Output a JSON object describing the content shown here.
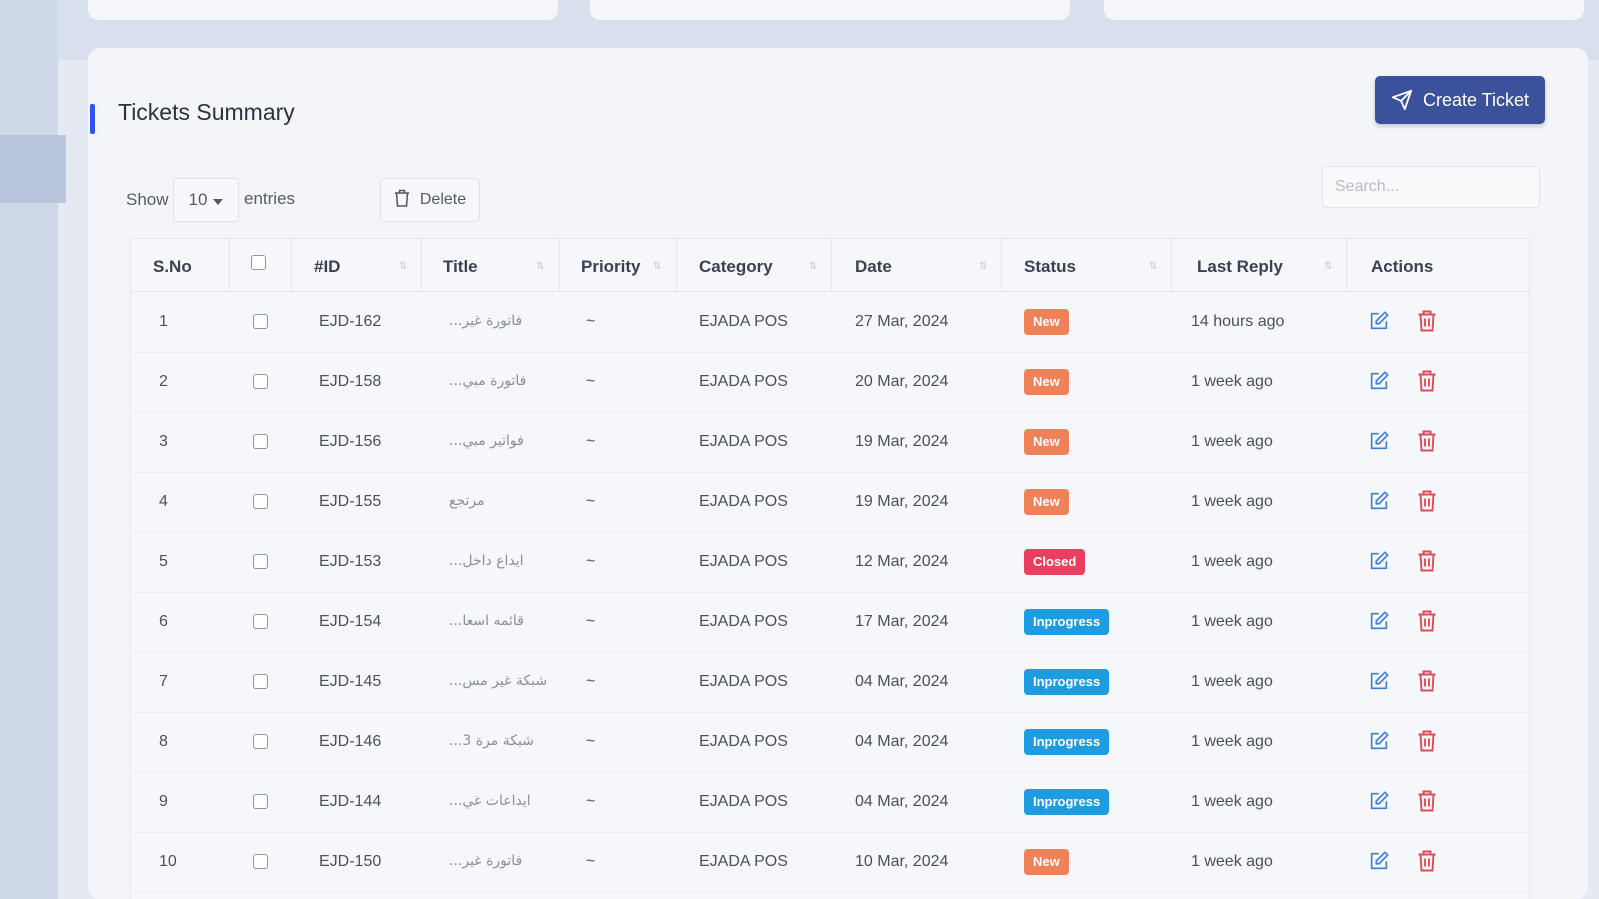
{
  "page": {
    "title": "Tickets Summary"
  },
  "header": {
    "create_button_label": "Create Ticket"
  },
  "controls": {
    "show_label": "Show",
    "entries_value": "10",
    "entries_label": "entries",
    "delete_label": "Delete",
    "search_placeholder": "Search..."
  },
  "table": {
    "columns": [
      "S.No",
      "#ID",
      "Title",
      "Priority",
      "Category",
      "Date",
      "Status",
      "Last Reply",
      "Actions"
    ],
    "rows": [
      {
        "sno": "1",
        "id": "EJD-162",
        "title": "فاتورة غير...",
        "priority": "~",
        "category": "EJADA POS",
        "date": "27 Mar, 2024",
        "status": "New",
        "last_reply": "14 hours ago"
      },
      {
        "sno": "2",
        "id": "EJD-158",
        "title": "فاتورة مبي...",
        "priority": "~",
        "category": "EJADA POS",
        "date": "20 Mar, 2024",
        "status": "New",
        "last_reply": "1 week ago"
      },
      {
        "sno": "3",
        "id": "EJD-156",
        "title": "فواتير مبي...",
        "priority": "~",
        "category": "EJADA POS",
        "date": "19 Mar, 2024",
        "status": "New",
        "last_reply": "1 week ago"
      },
      {
        "sno": "4",
        "id": "EJD-155",
        "title": "مرتجع",
        "priority": "~",
        "category": "EJADA POS",
        "date": "19 Mar, 2024",
        "status": "New",
        "last_reply": "1 week ago"
      },
      {
        "sno": "5",
        "id": "EJD-153",
        "title": "ايداع داخل...",
        "priority": "~",
        "category": "EJADA POS",
        "date": "12 Mar, 2024",
        "status": "Closed",
        "last_reply": "1 week ago"
      },
      {
        "sno": "6",
        "id": "EJD-154",
        "title": "قائمه اسعا...",
        "priority": "~",
        "category": "EJADA POS",
        "date": "17 Mar, 2024",
        "status": "Inprogress",
        "last_reply": "1 week ago"
      },
      {
        "sno": "7",
        "id": "EJD-145",
        "title": "شبكة غير مس...",
        "priority": "~",
        "category": "EJADA POS",
        "date": "04 Mar, 2024",
        "status": "Inprogress",
        "last_reply": "1 week ago"
      },
      {
        "sno": "8",
        "id": "EJD-146",
        "title": "شبكة مرة 3...",
        "priority": "~",
        "category": "EJADA POS",
        "date": "04 Mar, 2024",
        "status": "Inprogress",
        "last_reply": "1 week ago"
      },
      {
        "sno": "9",
        "id": "EJD-144",
        "title": "ايداعات غي...",
        "priority": "~",
        "category": "EJADA POS",
        "date": "04 Mar, 2024",
        "status": "Inprogress",
        "last_reply": "1 week ago"
      },
      {
        "sno": "10",
        "id": "EJD-150",
        "title": "فاتورة غير...",
        "priority": "~",
        "category": "EJADA POS",
        "date": "10 Mar, 2024",
        "status": "New",
        "last_reply": "1 week ago"
      }
    ]
  },
  "status_colors": {
    "New": "#f0825a",
    "Closed": "#ea3f5e",
    "Inprogress": "#1d9ce0"
  },
  "theme": {
    "primary": "#3b519b",
    "accent": "#2f54eb",
    "edit_icon": "#3f7ed8",
    "delete_icon": "#e04b57"
  }
}
